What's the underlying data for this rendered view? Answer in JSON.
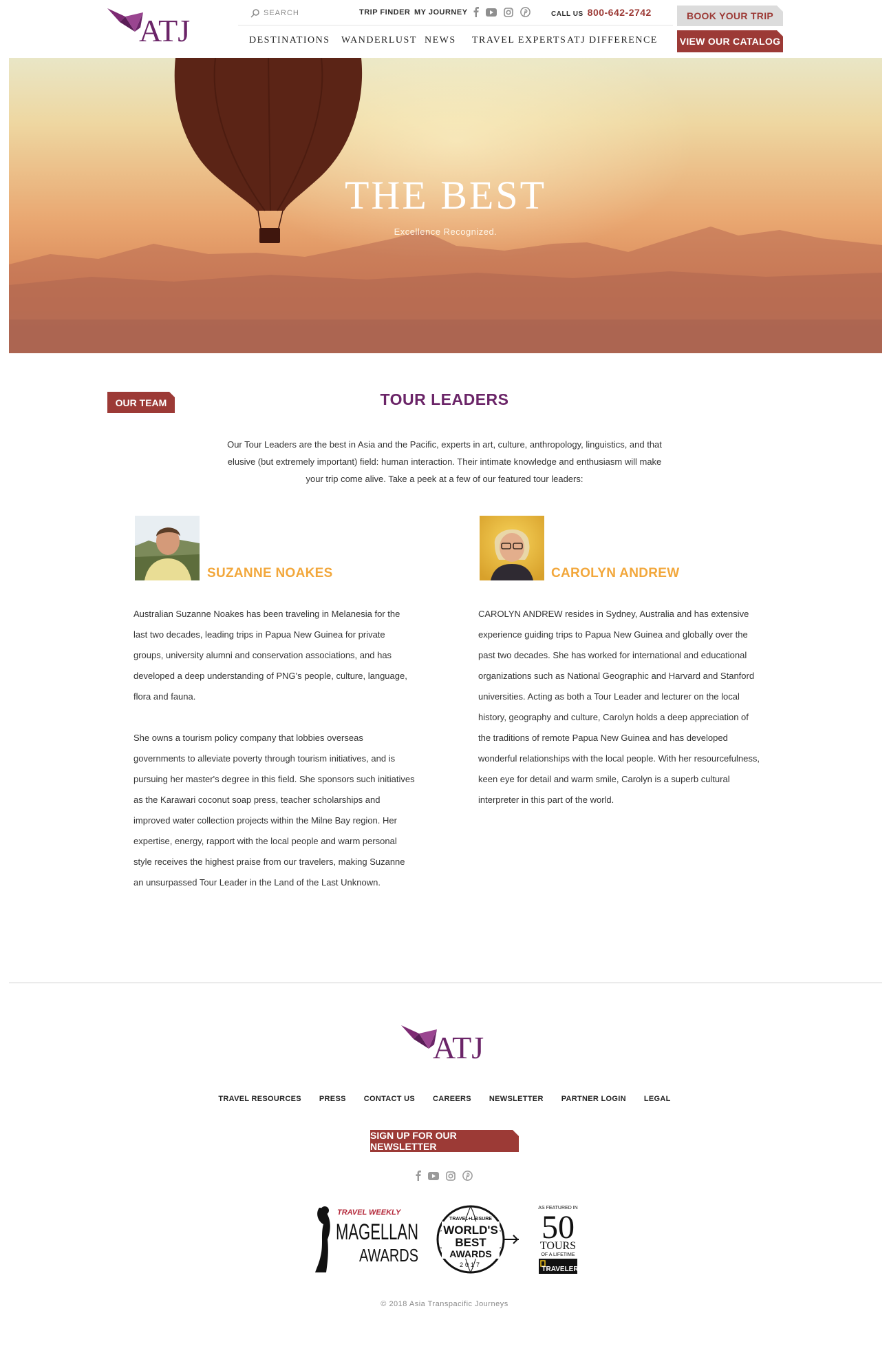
{
  "header": {
    "logo_text": "ATJ",
    "search_placeholder": "SEARCH",
    "links": {
      "trip_finder": "TRIP FINDER",
      "my_journey": "MY JOURNEY"
    },
    "call_label": "CALL US",
    "phone": "800-642-2742",
    "nav": [
      "DESTINATIONS",
      "WANDERLUST",
      "NEWS",
      "TRAVEL EXPERTS",
      "ATJ DIFFERENCE"
    ],
    "book_button": "BOOK YOUR TRIP",
    "catalog_button": "VIEW OUR CATALOG",
    "social_icons": [
      "facebook-icon",
      "youtube-icon",
      "instagram-icon",
      "pinterest-icon"
    ]
  },
  "hero": {
    "title": "THE BEST",
    "subtitle": "Excellence Recognized."
  },
  "section": {
    "tag": "OUR TEAM",
    "title": "TOUR LEADERS",
    "intro": "Our Tour Leaders are the best in Asia and the Pacific, experts in art, culture, anthropology, linguistics, and that elusive (but extremely important) field: human interaction. Their intimate knowledge and enthusiasm will make your trip come alive. Take a peek at a few of our featured tour leaders:"
  },
  "leaders": [
    {
      "name": "SUZANNE NOAKES",
      "paragraphs": [
        "Australian Suzanne Noakes has been traveling in Melanesia for the last two decades, leading trips in Papua New Guinea for private groups, university alumni and conservation associations, and has developed a deep understanding of PNG's people, culture, language, flora and fauna.",
        "She owns a tourism policy company that lobbies overseas governments to alleviate poverty through tourism initiatives, and is pursuing her master's degree in this field. She sponsors such initiatives as the Karawari coconut soap press, teacher scholarships and improved water collection projects within the Milne Bay region. Her expertise, energy, rapport with the local people and warm personal style receives the highest praise from our travelers, making Suzanne an unsurpassed Tour Leader in the Land of the Last Unknown."
      ]
    },
    {
      "name": "CAROLYN ANDREW",
      "paragraphs": [
        "CAROLYN ANDREW resides in Sydney, Australia and has extensive experience guiding trips to Papua New Guinea and globally over the past two decades. She has worked for international and educational organizations such as National Geographic and Harvard and Stanford universities. Acting as both a Tour Leader and lecturer on the local history, geography and culture, Carolyn holds a deep appreciation of the traditions of remote Papua New Guinea and has developed wonderful relationships with the local people. With her resourcefulness, keen eye for detail and warm smile, Carolyn is a superb cultural interpreter in this part of the world."
      ]
    }
  ],
  "footer": {
    "logo_text": "ATJ",
    "links": [
      "TRAVEL RESOURCES",
      "PRESS",
      "CONTACT US",
      "CAREERS",
      "NEWSLETTER",
      "PARTNER LOGIN",
      "LEGAL"
    ],
    "newsletter_button": "SIGN UP FOR OUR NEWSLETTER",
    "awards": {
      "magellan": {
        "top": "TRAVEL WEEKLY",
        "line1": "MAGELLAN",
        "line2": "AWARDS"
      },
      "worlds_best": {
        "brand": "TRAVEL+LEISURE",
        "line1": "WORLD'S",
        "line2": "BEST",
        "line3": "AWARDS",
        "year": "2017"
      },
      "tours50": {
        "top": "AS FEATURED IN",
        "number": "50",
        "line1": "TOURS",
        "line2": "OF A LIFETIME",
        "brand": "TRAVELER"
      }
    },
    "copyright": "© 2018 Asia Transpacific Journeys"
  },
  "colors": {
    "brand_purple": "#6b2568",
    "brand_red": "#9c3a36",
    "name_orange": "#f2a73b"
  }
}
